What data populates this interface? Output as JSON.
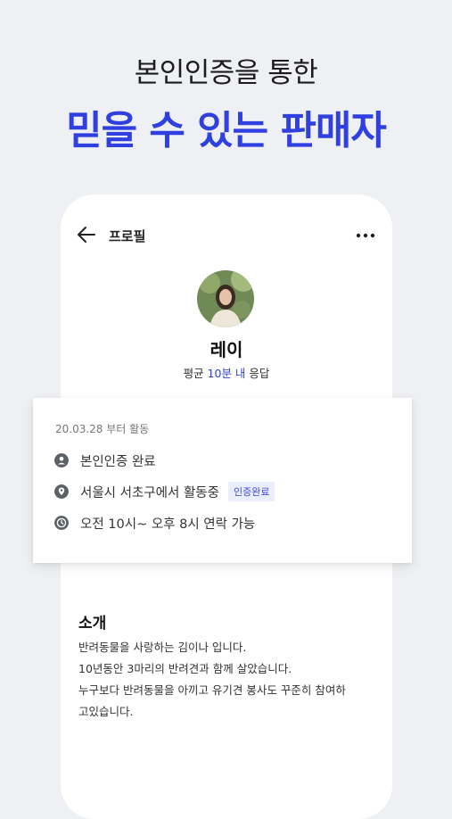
{
  "headline": {
    "top": "본인인증을 통한",
    "main": "믿을 수 있는 판매자"
  },
  "profile": {
    "topbar_title": "프로필",
    "nickname": "레이",
    "response_prefix": "평균 ",
    "response_highlight": "10분 내",
    "response_suffix": " 응답"
  },
  "info": {
    "since": "20.03.28 부터 활동",
    "rows": [
      {
        "icon": "person-icon",
        "text": "본인인증 완료"
      },
      {
        "icon": "location-icon",
        "text": "서울시 서초구에서 활동중",
        "badge": "인증완료"
      },
      {
        "icon": "clock-icon",
        "text": "오전 10시~ 오후 8시 연락 가능"
      }
    ]
  },
  "intro": {
    "title": "소개",
    "lines": [
      "반려동물을 사랑하는 김이나 입니다.",
      "10년동안 3마리의 반려견과 함께 살았습니다.",
      "누구보다 반려동물을 아끼고 유기견 봉사도 꾸준히 참여하",
      "고있습니다."
    ]
  },
  "colors": {
    "accent": "#2f3fe0",
    "background": "#eef0f3",
    "badge_bg": "#eceefc"
  }
}
